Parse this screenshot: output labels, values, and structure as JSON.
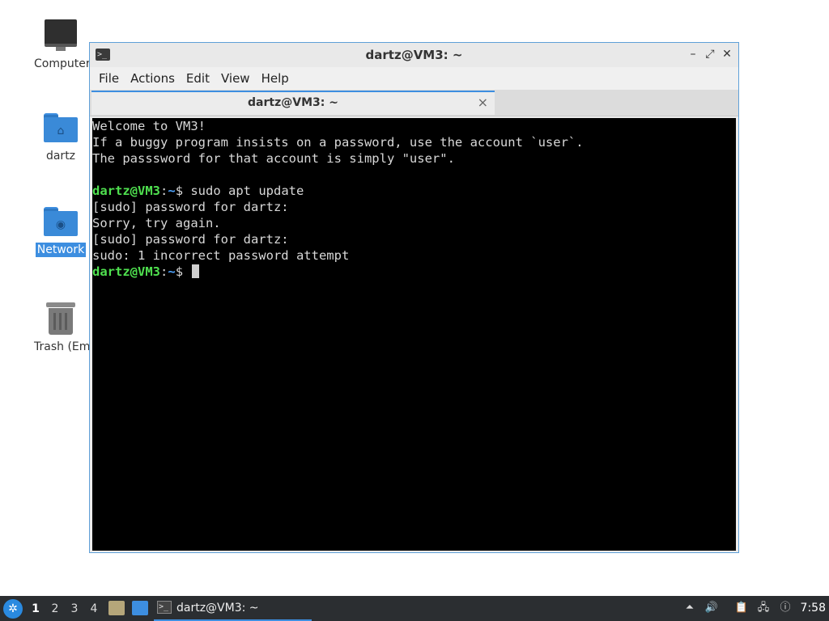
{
  "desktop": {
    "icons": [
      {
        "label": "Computer",
        "icon": "computer-icon"
      },
      {
        "label": "dartz",
        "icon": "home-folder-icon"
      },
      {
        "label": "Network",
        "icon": "network-folder-icon",
        "selected": true
      },
      {
        "label": "Trash (Empt",
        "icon": "trash-icon"
      }
    ]
  },
  "window": {
    "title": "dartz@VM3: ~",
    "controls": {
      "minimize": "–",
      "maximize": "⤢",
      "close": "✕"
    },
    "menu": [
      "File",
      "Actions",
      "Edit",
      "View",
      "Help"
    ],
    "tab": {
      "label": "dartz@VM3: ~",
      "close": "×"
    },
    "terminal": {
      "lines": [
        {
          "text": "Welcome to VM3!"
        },
        {
          "text": "If a buggy program insists on a password, use the account `user`."
        },
        {
          "text": "The passsword for that account is simply \"user\"."
        },
        {
          "text": ""
        },
        {
          "user": "dartz@VM3",
          "path": "~",
          "cmd": "$ sudo apt update"
        },
        {
          "text": "[sudo] password for dartz:"
        },
        {
          "text": "Sorry, try again."
        },
        {
          "text": "[sudo] password for dartz:"
        },
        {
          "text": "sudo: 1 incorrect password attempt"
        },
        {
          "user": "dartz@VM3",
          "path": "~",
          "cmd": "$ "
        }
      ]
    }
  },
  "taskbar": {
    "workspaces": [
      "1",
      "2",
      "3",
      "4"
    ],
    "active_workspace": "1",
    "task_label": "dartz@VM3: ~",
    "clock": "7:58"
  },
  "colors": {
    "accent": "#3d8ee0",
    "prompt_user": "#4fe04f",
    "prompt_path": "#4fa4ff",
    "terminal_bg": "#000000"
  }
}
